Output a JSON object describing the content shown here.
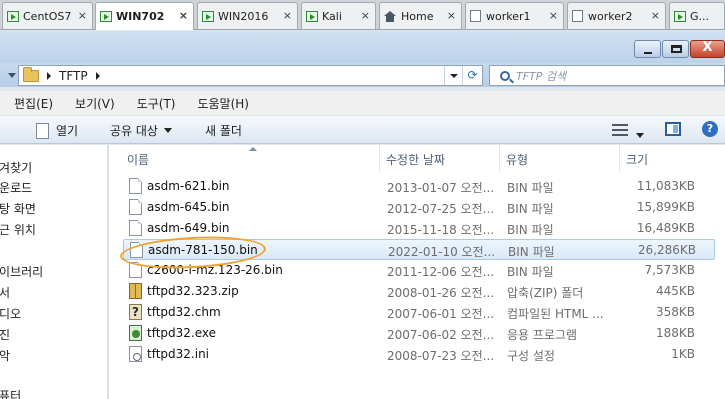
{
  "tabs": [
    {
      "label": "CentOS7",
      "icon": "vm-icon",
      "active": false
    },
    {
      "label": "WIN702",
      "icon": "vm-icon",
      "active": true
    },
    {
      "label": "WIN2016",
      "icon": "vm-icon",
      "active": false
    },
    {
      "label": "Kali",
      "icon": "vm-icon",
      "active": false
    },
    {
      "label": "Home",
      "icon": "home-icon",
      "active": false
    },
    {
      "label": "worker1",
      "icon": "document-icon",
      "active": false
    },
    {
      "label": "worker2",
      "icon": "document-icon",
      "active": false
    },
    {
      "label": "G...",
      "icon": "vm-icon",
      "active": false
    }
  ],
  "tab_close_glyph": "×",
  "window_buttons": {
    "close_glyph": "X"
  },
  "address": {
    "crumb": "TFTP",
    "refresh_glyph": "⟳"
  },
  "search": {
    "placeholder": "TFTP 검색"
  },
  "menu": [
    "편집(E)",
    "보기(V)",
    "도구(T)",
    "도움말(H)"
  ],
  "toolbar": {
    "open": "열기",
    "share": "공유 대상",
    "new_folder": "새 폴더",
    "help_glyph": "?"
  },
  "nav": [
    "즐겨찾기",
    "다운로드",
    "바탕 화면",
    "최근 위치",
    "라이브러리",
    "문서",
    "비디오",
    "사진",
    "음악",
    "컴퓨터"
  ],
  "columns": {
    "name": "이름",
    "date": "수정한 날짜",
    "type": "유형",
    "size": "크기"
  },
  "files": [
    {
      "name": "asdm-621.bin",
      "date": "2013-01-07 오전...",
      "type": "BIN 파일",
      "size": "11,083KB",
      "icon": "bin-file-icon",
      "selected": false
    },
    {
      "name": "asdm-645.bin",
      "date": "2012-07-25 오전...",
      "type": "BIN 파일",
      "size": "15,899KB",
      "icon": "bin-file-icon",
      "selected": false
    },
    {
      "name": "asdm-649.bin",
      "date": "2015-11-18 오전...",
      "type": "BIN 파일",
      "size": "16,489KB",
      "icon": "bin-file-icon",
      "selected": false
    },
    {
      "name": "asdm-781-150.bin",
      "date": "2022-01-10 오전...",
      "type": "BIN 파일",
      "size": "26,286KB",
      "icon": "bin-file-icon",
      "selected": true
    },
    {
      "name": "c2600-i-mz.123-26.bin",
      "date": "2011-12-06 오전...",
      "type": "BIN 파일",
      "size": "7,573KB",
      "icon": "bin-file-icon",
      "selected": false
    },
    {
      "name": "tftpd32.323.zip",
      "date": "2008-01-26 오전...",
      "type": "압축(ZIP) 폴더",
      "size": "445KB",
      "icon": "zip-folder-icon",
      "selected": false
    },
    {
      "name": "tftpd32.chm",
      "date": "2007-06-01 오전...",
      "type": "컴파일된 HTML ...",
      "size": "358KB",
      "icon": "chm-help-icon",
      "selected": false
    },
    {
      "name": "tftpd32.exe",
      "date": "2007-06-02 오전...",
      "type": "응용 프로그램",
      "size": "188KB",
      "icon": "exe-app-icon",
      "selected": false
    },
    {
      "name": "tftpd32.ini",
      "date": "2008-07-23 오전...",
      "type": "구성 설정",
      "size": "1KB",
      "icon": "ini-settings-icon",
      "selected": false
    }
  ]
}
